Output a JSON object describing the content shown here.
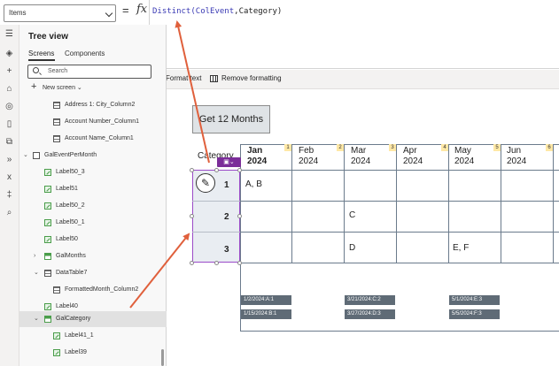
{
  "formula_bar": {
    "property": "Items",
    "equals": "=",
    "fx": "fx",
    "formula_fn": "Distinct",
    "formula_open": "(",
    "formula_arg1": "ColEvent",
    "formula_sep": ",",
    "formula_arg2": "Category",
    "formula_close": ")",
    "format_text": "Format text",
    "remove_formatting": "Remove formatting"
  },
  "tree_view": {
    "title": "Tree view",
    "tabs": [
      "Screens",
      "Components"
    ],
    "search_placeholder": "Search",
    "new_screen": "New screen",
    "items": [
      {
        "label": "Address 1: City_Column2",
        "icon": "table-column-icon"
      },
      {
        "label": "Account Number_Column1",
        "icon": "table-column-icon"
      },
      {
        "label": "Account Name_Column1",
        "icon": "table-column-icon"
      },
      {
        "label": "GalEventPerMonth",
        "icon": "screen-icon"
      },
      {
        "label": "Label50_3",
        "icon": "label-icon"
      },
      {
        "label": "Label51",
        "icon": "label-icon"
      },
      {
        "label": "Label50_2",
        "icon": "label-icon"
      },
      {
        "label": "Label50_1",
        "icon": "label-icon"
      },
      {
        "label": "Label50",
        "icon": "label-icon"
      },
      {
        "label": "GalMonths",
        "icon": "gallery-icon"
      },
      {
        "label": "DataTable7",
        "icon": "table-icon"
      },
      {
        "label": "FormattedMonth_Column2",
        "icon": "table-column-icon"
      },
      {
        "label": "Label40",
        "icon": "label-icon"
      },
      {
        "label": "GalCategory",
        "icon": "gallery-icon",
        "selected": true
      },
      {
        "label": "Label41_1",
        "icon": "label-icon"
      },
      {
        "label": "Label39",
        "icon": "label-icon"
      }
    ]
  },
  "canvas": {
    "get_button": "Get 12 Months",
    "category_header": "Category",
    "months": [
      {
        "name": "Jan",
        "year": "2024",
        "index": "1"
      },
      {
        "name": "Feb",
        "year": "2024",
        "index": "2"
      },
      {
        "name": "Mar",
        "year": "2024",
        "index": "3"
      },
      {
        "name": "Apr",
        "year": "2024",
        "index": "4"
      },
      {
        "name": "May",
        "year": "2024",
        "index": "5"
      },
      {
        "name": "Jun",
        "year": "2024",
        "index": "6"
      }
    ],
    "categories": [
      "1",
      "2",
      "3"
    ],
    "cells": {
      "c1_jan": "A, B",
      "c2_mar": "C",
      "c3_mar": "D",
      "c3_may": "E, F"
    },
    "events": {
      "jan_1": "1/2/2024:A:1",
      "jan_2": "1/15/2024:B:1",
      "mar_1": "3/21/2024:C:2",
      "mar_2": "3/27/2024:D:3",
      "may_1": "5/1/2024:E:3",
      "may_2": "5/5/2024:F:3"
    }
  },
  "colors": {
    "gallery_selection": "#9b4bc8",
    "gallery_tag": "#7b2d99",
    "arrow": "#e0603c",
    "event_chip": "#5f6b76"
  }
}
